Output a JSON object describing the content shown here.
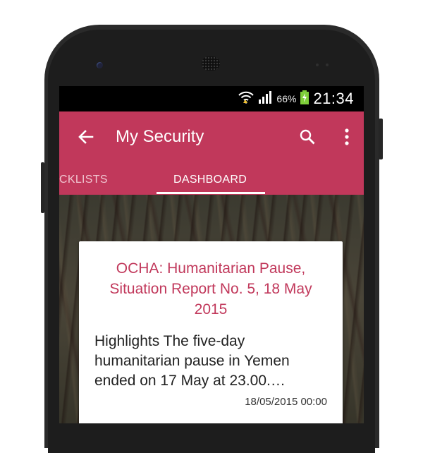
{
  "status_bar": {
    "battery_percent": "66%",
    "time": "21:34",
    "icons": [
      "wifi-icon",
      "signal-icon",
      "battery-charging-icon"
    ]
  },
  "app_bar": {
    "title": "My Security",
    "icons": [
      "back-arrow-icon",
      "search-icon",
      "overflow-menu-icon"
    ]
  },
  "tabs": [
    {
      "label": "CKLISTS",
      "selected": false
    },
    {
      "label": "DASHBOARD",
      "selected": true
    }
  ],
  "card": {
    "title": "OCHA: Humanitarian Pause, Situation Report No. 5, 18 May 2015",
    "body": "Highlights The five-day humanitarian pause in Yemen ended on 17 May at 23.00.…",
    "date": "18/05/2015 00:00"
  },
  "colors": {
    "primary": "#c1385b",
    "status_bar": "#000000",
    "card_bg": "#ffffff",
    "title_text": "#c1385b"
  }
}
